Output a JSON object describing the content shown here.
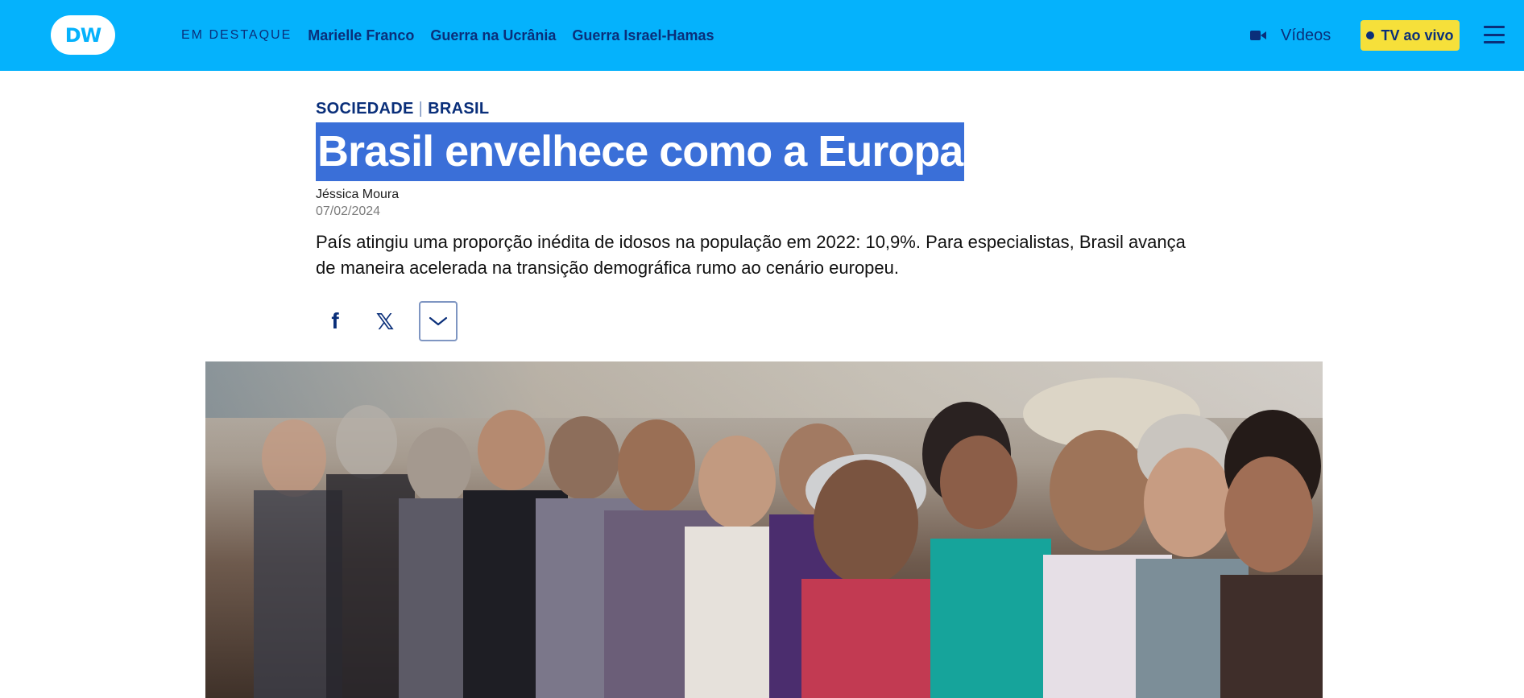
{
  "header": {
    "logo_text": "DW",
    "highlight_label": "EM DESTAQUE",
    "nav_links": [
      "Marielle Franco",
      "Guerra na Ucrânia",
      "Guerra Israel-Hamas"
    ],
    "videos_label": "Vídeos",
    "tv_live_label": "TV ao vivo",
    "brand_color": "#05b2fc",
    "accent_color": "#f6e03a",
    "icons": [
      "video-camera-icon",
      "menu-icon"
    ]
  },
  "article": {
    "category": "SOCIEDADE",
    "region": "BRASIL",
    "title": "Brasil envelhece como a Europa",
    "author": "Jéssica Moura",
    "date": "07/02/2024",
    "teaser": "País atingiu uma proporção inédita de idosos na população em 2022: 10,9%. Para especialistas, Brasil avança de maneira acelerada na transição demográfica rumo ao cenário europeu.",
    "share": {
      "facebook_glyph": "f",
      "x_glyph": "𝕏"
    },
    "title_selected_color": "#3a6fd8"
  },
  "hero_image": {
    "subject": "group-of-elderly-people-photo"
  }
}
